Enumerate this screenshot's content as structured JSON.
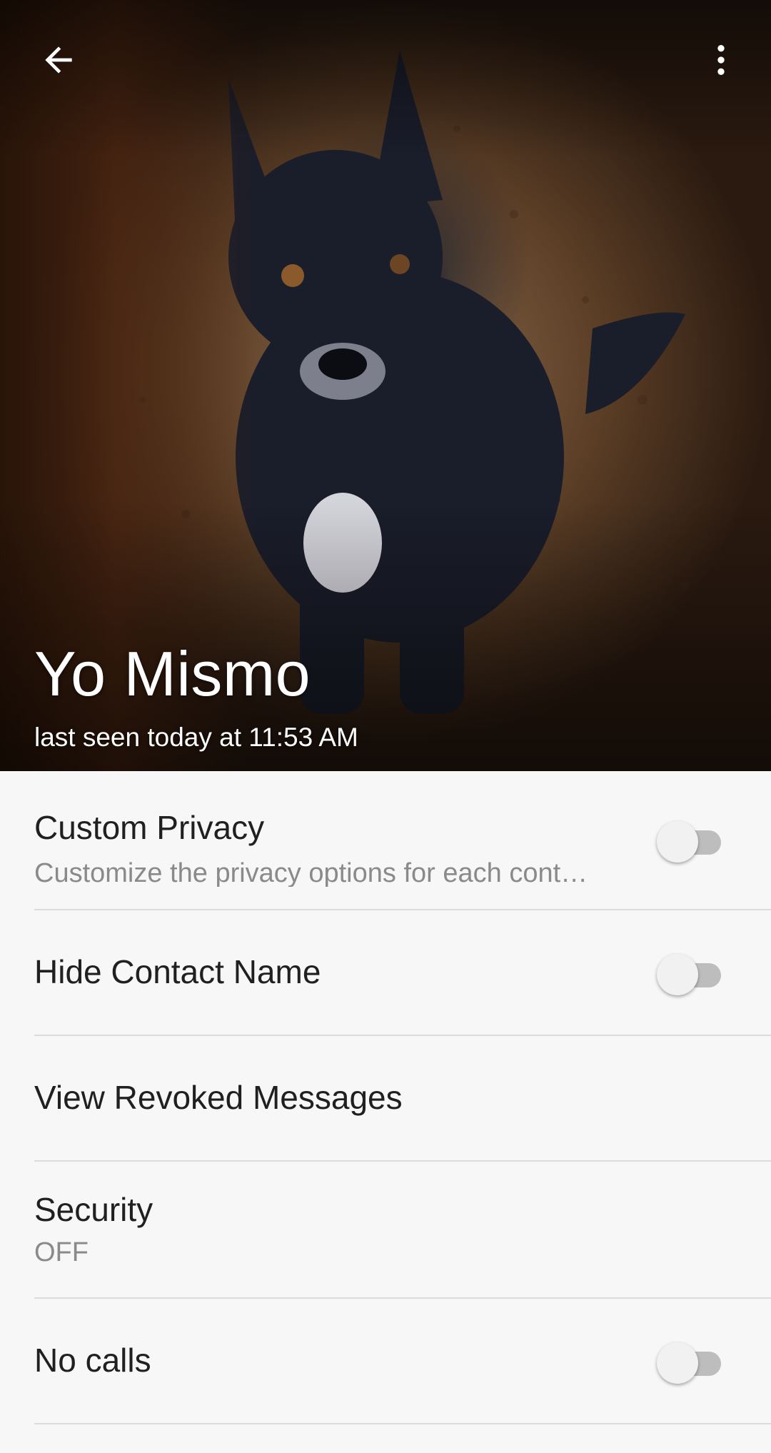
{
  "header": {
    "contact_name": "Yo Mismo",
    "last_seen": "last seen today at 11:53 AM",
    "back_icon": "arrow-back-icon",
    "menu_icon": "more-vertical-icon"
  },
  "settings": [
    {
      "title": "Custom Privacy",
      "subtitle": "Customize the privacy options for each cont…",
      "toggle": false
    },
    {
      "title": "Hide Contact Name",
      "toggle": false
    },
    {
      "title": "View Revoked Messages"
    },
    {
      "title": "Security",
      "subtitle": "OFF"
    },
    {
      "title": "No calls",
      "toggle": false
    }
  ],
  "colors": {
    "switch_track_off": "#bdbdbd",
    "switch_thumb_off": "#f1f1f1",
    "divider": "#dcdcdc",
    "background": "#f7f7f7"
  }
}
